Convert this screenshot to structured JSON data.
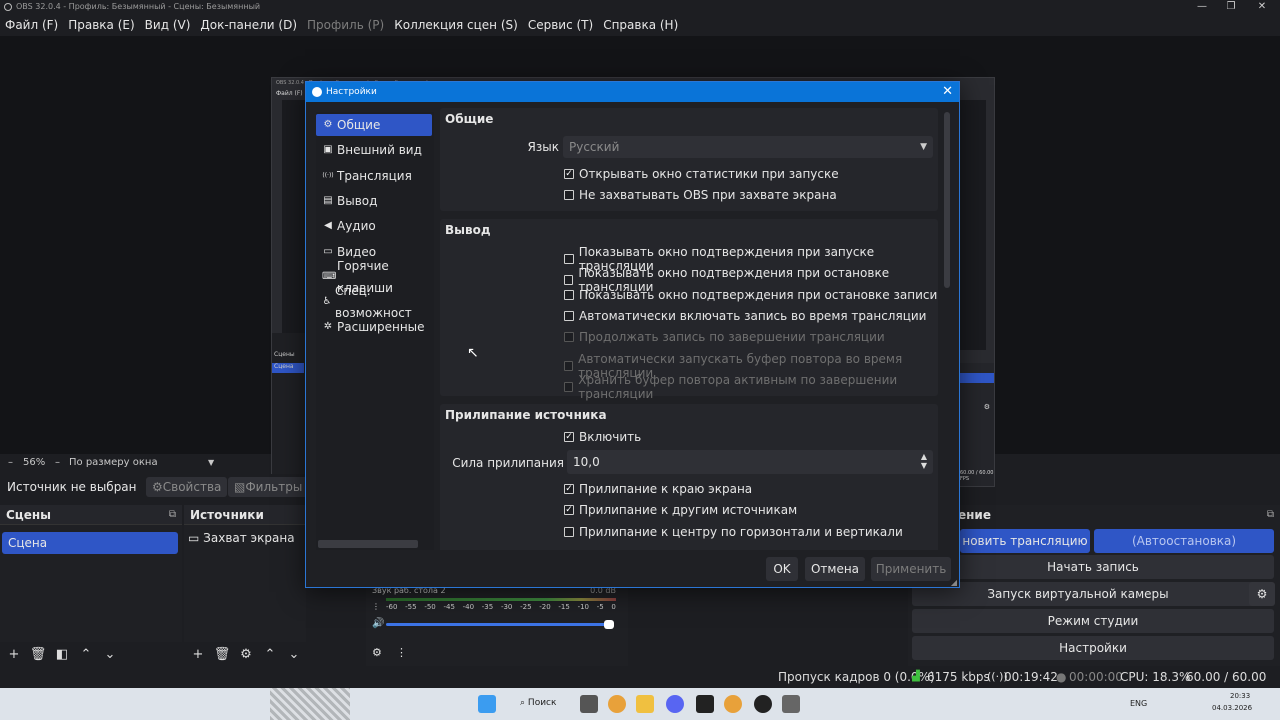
{
  "window": {
    "title": "OBS 32.0.4 - Профиль: Безымянный - Сцены: Безымянный"
  },
  "menubar": [
    {
      "label": "Файл (F)",
      "disabled": false
    },
    {
      "label": "Правка (E)",
      "disabled": false
    },
    {
      "label": "Вид (V)",
      "disabled": false
    },
    {
      "label": "Док-панели (D)",
      "disabled": false
    },
    {
      "label": "Профиль (P)",
      "disabled": true
    },
    {
      "label": "Коллекция сцен (S)",
      "disabled": false
    },
    {
      "label": "Сервис (T)",
      "disabled": false
    },
    {
      "label": "Справка (H)",
      "disabled": false
    }
  ],
  "zoom": {
    "value": "56%",
    "mode": "По размеру окна"
  },
  "source_bar": {
    "status": "Источник не выбран",
    "properties": "Свойства",
    "filters": "Фильтры"
  },
  "scenes": {
    "title": "Сцены",
    "items": [
      "Сцена"
    ]
  },
  "sources": {
    "title": "Источники",
    "items": [
      "Захват экрана"
    ]
  },
  "mixer": {
    "track": "Звук раб. стола 2",
    "level": "0.0 dB",
    "scale": [
      "-60",
      "-55",
      "-50",
      "-45",
      "-40",
      "-35",
      "-30",
      "-25",
      "-20",
      "-15",
      "-10",
      "-5",
      "0"
    ]
  },
  "controls": {
    "title": "ение",
    "stop_stream": "новить трансляцию",
    "autostop": "(Автоостановка)",
    "start_recording": "Начать запись",
    "virtual_cam": "Запуск виртуальной камеры",
    "studio_mode": "Режим студии",
    "settings": "Настройки"
  },
  "statusbar": {
    "dropped": "Пропуск кадров 0 (0.0%)",
    "bitrate": "6175 kbps",
    "stream_time": "00:19:42",
    "rec_time": "00:00:00",
    "cpu": "CPU: 18.3%",
    "fps": "60.00 / 60.00 FPS"
  },
  "taskbar": {
    "search": "Поиск",
    "lang": "ENG",
    "time": "20:33",
    "date": "04.03.2026"
  },
  "dialog": {
    "title": "Настройки",
    "sidebar": [
      {
        "label": "Общие",
        "icon": "gear-icon",
        "glyph": "⚙",
        "active": true
      },
      {
        "label": "Внешний вид",
        "icon": "appearance-icon",
        "glyph": "▣",
        "active": false
      },
      {
        "label": "Трансляция",
        "icon": "broadcast-icon",
        "glyph": "((·))",
        "active": false
      },
      {
        "label": "Вывод",
        "icon": "output-icon",
        "glyph": "▤",
        "active": false
      },
      {
        "label": "Аудио",
        "icon": "speaker-icon",
        "glyph": "◀",
        "active": false
      },
      {
        "label": "Видео",
        "icon": "monitor-icon",
        "glyph": "▭",
        "active": false
      },
      {
        "label": "Горячие клавиши",
        "icon": "keyboard-icon",
        "glyph": "⌨",
        "active": false
      },
      {
        "label": "Спец. возможност",
        "icon": "accessibility-icon",
        "glyph": "♿",
        "active": false
      },
      {
        "label": "Расширенные",
        "icon": "wrench-icon",
        "glyph": "✲",
        "active": false
      }
    ],
    "general": {
      "title": "Общие",
      "language_label": "Язык",
      "language_value": "Русский",
      "checks": [
        {
          "label": "Открывать окно статистики при запуске",
          "checked": true,
          "disabled": false
        },
        {
          "label": "Не захватывать OBS при захвате экрана",
          "checked": false,
          "disabled": false
        }
      ]
    },
    "output": {
      "title": "Вывод",
      "checks": [
        {
          "label": "Показывать окно подтверждения при запуске трансляции",
          "checked": false,
          "disabled": false
        },
        {
          "label": "Показывать окно подтверждения при остановке трансляции",
          "checked": false,
          "disabled": false
        },
        {
          "label": "Показывать окно подтверждения при остановке записи",
          "checked": false,
          "disabled": false
        },
        {
          "label": "Автоматически включать запись во время трансляции",
          "checked": false,
          "disabled": false
        },
        {
          "label": "Продолжать запись по завершении трансляции",
          "checked": false,
          "disabled": true
        },
        {
          "label": "Автоматически запускать буфер повтора во время трансляции",
          "checked": false,
          "disabled": true
        },
        {
          "label": "Хранить буфер повтора активным по завершении трансляции",
          "checked": false,
          "disabled": true
        }
      ]
    },
    "snapping": {
      "title": "Прилипание источника",
      "enable": {
        "label": "Включить",
        "checked": true
      },
      "strength_label": "Сила прилипания",
      "strength_value": "10,0",
      "checks": [
        {
          "label": "Прилипание к краю экрана",
          "checked": true
        },
        {
          "label": "Прилипание к другим источникам",
          "checked": true
        },
        {
          "label": "Прилипание к центру по горизонтали и вертикали",
          "checked": false
        }
      ]
    },
    "buttons": {
      "ok": "OK",
      "cancel": "Отмена",
      "apply": "Применить"
    }
  }
}
